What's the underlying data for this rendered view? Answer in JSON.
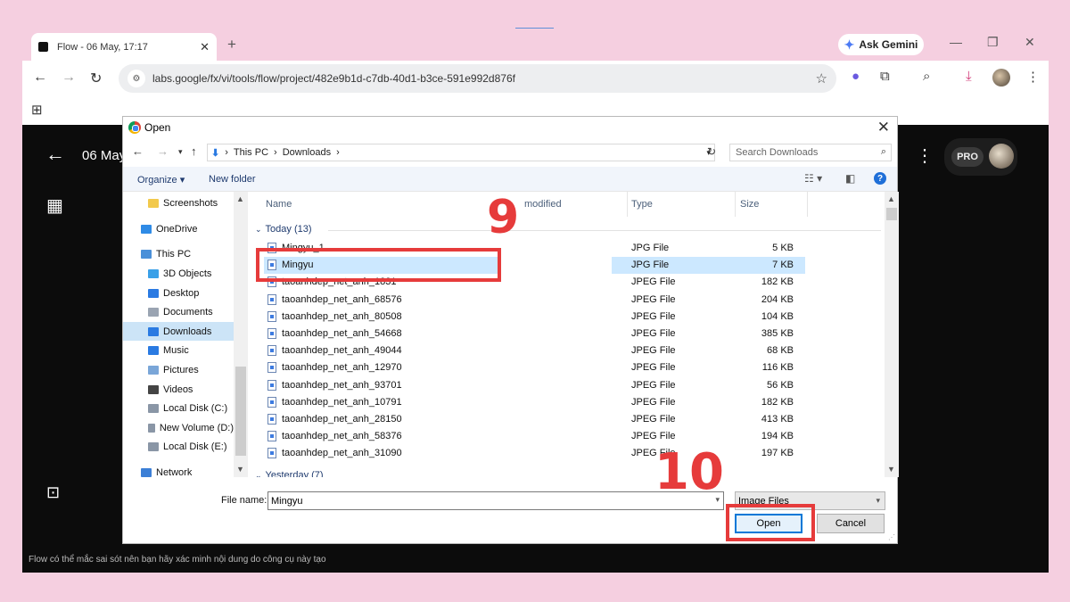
{
  "browser": {
    "tab_title": "Flow - 06 May, 17:17",
    "tab_close": "✕",
    "new_tab": "+",
    "gemini_label": "Ask Gemini",
    "url": "labs.google/fx/vi/tools/flow/project/482e9b1d-c7db-40d1-b3ce-591e992d876f"
  },
  "page": {
    "project_title": "06 May",
    "badge": "PRO",
    "footer_note": "Flow có thể mắc sai sót nên bạn hãy xác minh nội dung do công cụ này tạo"
  },
  "dialog": {
    "title": "Open",
    "breadcrumb": [
      "This PC",
      "Downloads"
    ],
    "search_placeholder": "Search Downloads",
    "organize": "Organize ▾",
    "new_folder": "New folder",
    "nav_items": [
      {
        "label": "Screenshots",
        "color": "#f2c94c"
      },
      {
        "label": "OneDrive",
        "color": "#2f8be6"
      },
      {
        "label": "This PC",
        "color": "#4a90d9"
      },
      {
        "label": "3D Objects",
        "color": "#3aa0e8"
      },
      {
        "label": "Desktop",
        "color": "#2a7ae2"
      },
      {
        "label": "Documents",
        "color": "#9aa4b2"
      },
      {
        "label": "Downloads",
        "color": "#2a7ae2"
      },
      {
        "label": "Music",
        "color": "#2a7ae2"
      },
      {
        "label": "Pictures",
        "color": "#7aa6d8"
      },
      {
        "label": "Videos",
        "color": "#444"
      },
      {
        "label": "Local Disk (C:)",
        "color": "#8a96a6"
      },
      {
        "label": "New Volume (D:)",
        "color": "#8a96a6"
      },
      {
        "label": "Local Disk (E:)",
        "color": "#8a96a6"
      },
      {
        "label": "Network",
        "color": "#3c7fd6"
      }
    ],
    "columns": {
      "name": "Name",
      "modified": "modified",
      "type": "Type",
      "size": "Size"
    },
    "group_today": "Today (13)",
    "group_yesterday": "Yesterday (7)",
    "files": [
      {
        "name": "Mingyu_1",
        "type": "JPG File",
        "size": "5 KB"
      },
      {
        "name": "Mingyu",
        "type": "JPG File",
        "size": "7 KB"
      },
      {
        "name": "taoanhdep_net_anh_1831",
        "type": "JPEG File",
        "size": "182 KB"
      },
      {
        "name": "taoanhdep_net_anh_68576",
        "type": "JPEG File",
        "size": "204 KB"
      },
      {
        "name": "taoanhdep_net_anh_80508",
        "type": "JPEG File",
        "size": "104 KB"
      },
      {
        "name": "taoanhdep_net_anh_54668",
        "type": "JPEG File",
        "size": "385 KB"
      },
      {
        "name": "taoanhdep_net_anh_49044",
        "type": "JPEG File",
        "size": "68 KB"
      },
      {
        "name": "taoanhdep_net_anh_12970",
        "type": "JPEG File",
        "size": "116 KB"
      },
      {
        "name": "taoanhdep_net_anh_93701",
        "type": "JPEG File",
        "size": "56 KB"
      },
      {
        "name": "taoanhdep_net_anh_10791",
        "type": "JPEG File",
        "size": "182 KB"
      },
      {
        "name": "taoanhdep_net_anh_28150",
        "type": "JPEG File",
        "size": "413 KB"
      },
      {
        "name": "taoanhdep_net_anh_58376",
        "type": "JPEG File",
        "size": "194 KB"
      },
      {
        "name": "taoanhdep_net_anh_31090",
        "type": "JPEG File",
        "size": "197 KB"
      }
    ],
    "file_name_label": "File name:",
    "file_name_value": "Mingyu",
    "file_type_value": "Image Files",
    "open_label": "Open",
    "cancel_label": "Cancel"
  },
  "annotations": {
    "step_9": "9",
    "step_10": "10",
    "color": "#e63b3b"
  }
}
